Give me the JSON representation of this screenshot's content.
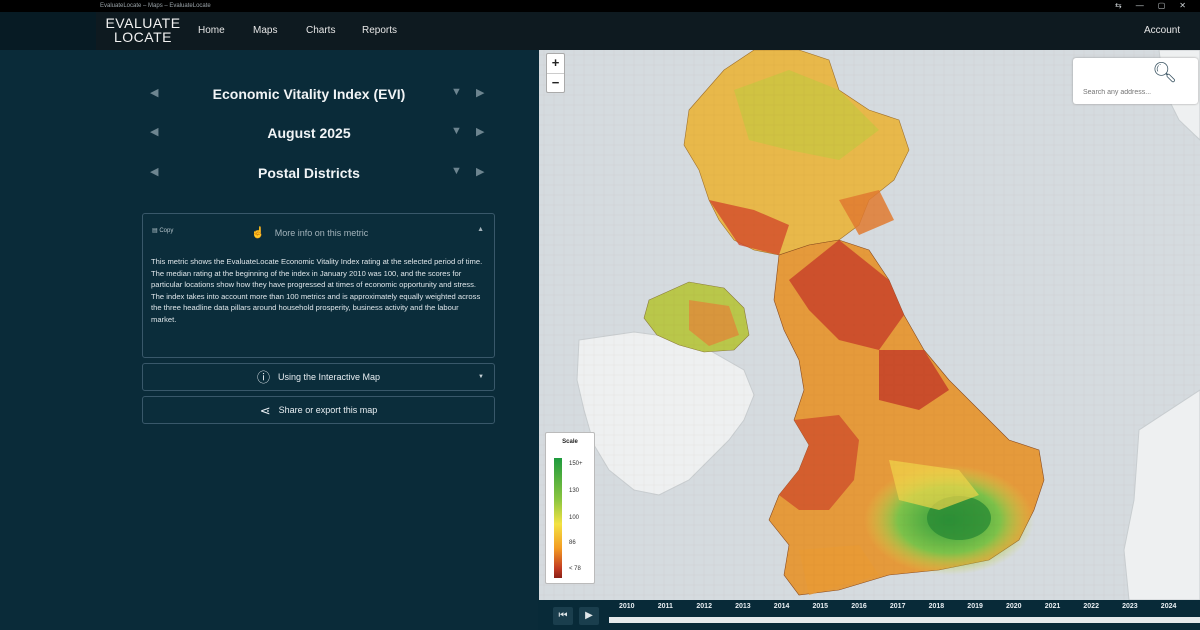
{
  "window": {
    "title": "EvaluateLocate – Maps – EvaluateLocate"
  },
  "nav": {
    "logo_line1": "EVALUATE",
    "logo_line2": "LOCATE",
    "links": [
      "Home",
      "Maps",
      "Charts",
      "Reports"
    ],
    "account": "Account"
  },
  "selectors": {
    "metric": "Economic Vitality Index (EVI)",
    "period": "August 2025",
    "geography": "Postal Districts"
  },
  "info": {
    "copy_label": "Copy",
    "more_info_label": "More info on this metric",
    "description": "This metric shows the EvaluateLocate Economic Vitality Index rating at the selected period of time. The median rating at the beginning of the index in January 2010 was 100, and the scores for particular locations show how they have progressed at times of economic opportunity and stress. The index takes into account more than 100 metrics and is approximately equally weighted across the three headline data pillars around household prosperity, business activity and the labour market."
  },
  "buttons": {
    "interactive_map": "Using the Interactive Map",
    "share": "Share or export this map"
  },
  "map": {
    "search_placeholder": "Search any address...",
    "legend": {
      "title": "Scale",
      "ticks": [
        "150+",
        "130",
        "100",
        "86",
        "< 78"
      ]
    }
  },
  "timeline": {
    "years": [
      "2010",
      "2011",
      "2012",
      "2013",
      "2014",
      "2015",
      "2016",
      "2017",
      "2018",
      "2019",
      "2020",
      "2021",
      "2022",
      "2023",
      "2024"
    ]
  },
  "colors": {
    "sidebar_bg": "#0a2b39",
    "nav_bg": "#0e1a20",
    "sea": "#d5dbdf",
    "land_grey": "#eef0f1",
    "evi_high": "#2e9a3e",
    "evi_mid": "#f3d34a",
    "evi_low": "#c2352a"
  }
}
